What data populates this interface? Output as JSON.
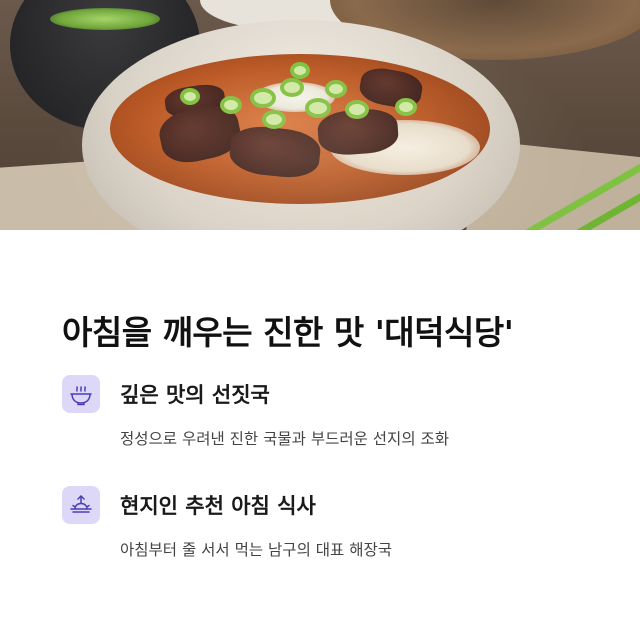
{
  "headline": "아침을 깨우는 진한 맛 '대덕식당'",
  "features": [
    {
      "icon": "soup-bowl-icon",
      "title": "깊은 맛의 선짓국",
      "description": "정성으로 우려낸 진한 국물과 부드러운 선지의 조화"
    },
    {
      "icon": "sunrise-icon",
      "title": "현지인 추천 아침 식사",
      "description": "아침부터 줄 서서 먹는 남구의 대표 해장국"
    }
  ],
  "colors": {
    "icon_background": "#ddd8f7",
    "icon_stroke": "#4b3fb5",
    "headline": "#111111",
    "body_text": "#444444"
  }
}
